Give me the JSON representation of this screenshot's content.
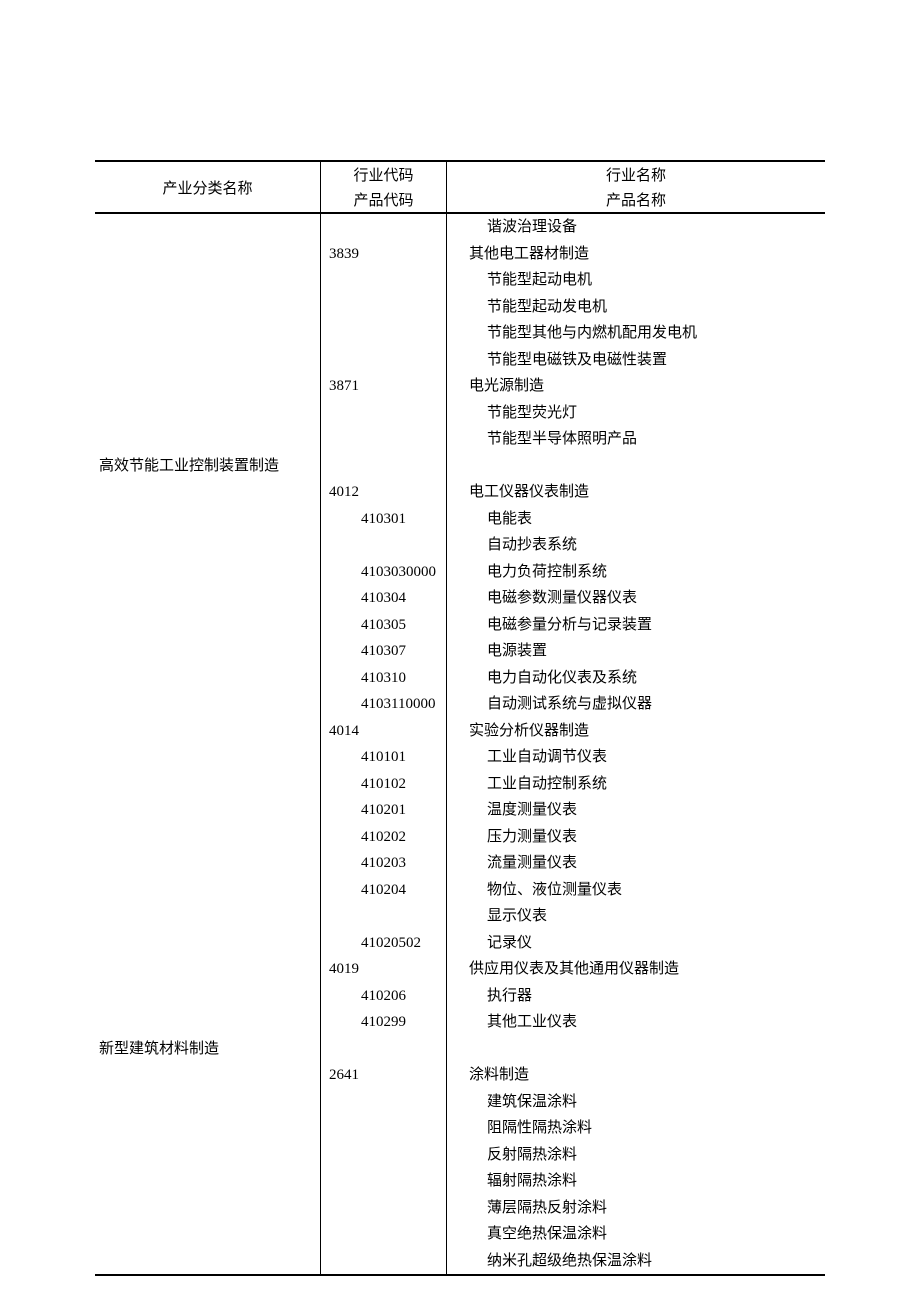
{
  "header": {
    "col1": "产业分类名称",
    "col2_line1": "行业代码",
    "col2_line2": "产品代码",
    "col3_line1": "行业名称",
    "col3_line2": "产品名称"
  },
  "rows": [
    {
      "category": "",
      "code": "",
      "codeLevel": "industry",
      "name": "谐波治理设备",
      "nameLevel": "product"
    },
    {
      "category": "",
      "code": "3839",
      "codeLevel": "industry",
      "name": "其他电工器材制造",
      "nameLevel": "industry"
    },
    {
      "category": "",
      "code": "",
      "codeLevel": "industry",
      "name": "节能型起动电机",
      "nameLevel": "product"
    },
    {
      "category": "",
      "code": "",
      "codeLevel": "industry",
      "name": "节能型起动发电机",
      "nameLevel": "product"
    },
    {
      "category": "",
      "code": "",
      "codeLevel": "industry",
      "name": "节能型其他与内燃机配用发电机",
      "nameLevel": "product"
    },
    {
      "category": "",
      "code": "",
      "codeLevel": "industry",
      "name": "节能型电磁铁及电磁性装置",
      "nameLevel": "product"
    },
    {
      "category": "",
      "code": "3871",
      "codeLevel": "industry",
      "name": "电光源制造",
      "nameLevel": "industry"
    },
    {
      "category": "",
      "code": "",
      "codeLevel": "industry",
      "name": "节能型荧光灯",
      "nameLevel": "product"
    },
    {
      "category": "",
      "code": "",
      "codeLevel": "industry",
      "name": "节能型半导体照明产品",
      "nameLevel": "product"
    },
    {
      "category": "高效节能工业控制装置制造",
      "code": "",
      "codeLevel": "industry",
      "name": "",
      "nameLevel": "industry"
    },
    {
      "category": "",
      "code": "4012",
      "codeLevel": "industry",
      "name": "电工仪器仪表制造",
      "nameLevel": "industry"
    },
    {
      "category": "",
      "code": "410301",
      "codeLevel": "product",
      "name": "电能表",
      "nameLevel": "product"
    },
    {
      "category": "",
      "code": "",
      "codeLevel": "product",
      "name": "自动抄表系统",
      "nameLevel": "product"
    },
    {
      "category": "",
      "code": "4103030000",
      "codeLevel": "product",
      "name": "电力负荷控制系统",
      "nameLevel": "product"
    },
    {
      "category": "",
      "code": "410304",
      "codeLevel": "product",
      "name": "电磁参数测量仪器仪表",
      "nameLevel": "product"
    },
    {
      "category": "",
      "code": "410305",
      "codeLevel": "product",
      "name": "电磁参量分析与记录装置",
      "nameLevel": "product"
    },
    {
      "category": "",
      "code": "410307",
      "codeLevel": "product",
      "name": "电源装置",
      "nameLevel": "product"
    },
    {
      "category": "",
      "code": "410310",
      "codeLevel": "product",
      "name": "电力自动化仪表及系统",
      "nameLevel": "product"
    },
    {
      "category": "",
      "code": "4103110000",
      "codeLevel": "product",
      "name": "自动测试系统与虚拟仪器",
      "nameLevel": "product"
    },
    {
      "category": "",
      "code": "4014",
      "codeLevel": "industry",
      "name": "实验分析仪器制造",
      "nameLevel": "industry"
    },
    {
      "category": "",
      "code": "410101",
      "codeLevel": "product",
      "name": "工业自动调节仪表",
      "nameLevel": "product"
    },
    {
      "category": "",
      "code": "410102",
      "codeLevel": "product",
      "name": "工业自动控制系统",
      "nameLevel": "product"
    },
    {
      "category": "",
      "code": "410201",
      "codeLevel": "product",
      "name": "温度测量仪表",
      "nameLevel": "product"
    },
    {
      "category": "",
      "code": "410202",
      "codeLevel": "product",
      "name": "压力测量仪表",
      "nameLevel": "product"
    },
    {
      "category": "",
      "code": "410203",
      "codeLevel": "product",
      "name": "流量测量仪表",
      "nameLevel": "product"
    },
    {
      "category": "",
      "code": "410204",
      "codeLevel": "product",
      "name": "物位、液位测量仪表",
      "nameLevel": "product"
    },
    {
      "category": "",
      "code": "",
      "codeLevel": "product",
      "name": "显示仪表",
      "nameLevel": "product"
    },
    {
      "category": "",
      "code": "41020502",
      "codeLevel": "product",
      "name": "记录仪",
      "nameLevel": "product"
    },
    {
      "category": "",
      "code": "4019",
      "codeLevel": "industry",
      "name": "供应用仪表及其他通用仪器制造",
      "nameLevel": "industry"
    },
    {
      "category": "",
      "code": "410206",
      "codeLevel": "product",
      "name": "执行器",
      "nameLevel": "product"
    },
    {
      "category": "",
      "code": "410299",
      "codeLevel": "product",
      "name": "其他工业仪表",
      "nameLevel": "product"
    },
    {
      "category": "新型建筑材料制造",
      "code": "",
      "codeLevel": "industry",
      "name": "",
      "nameLevel": "industry"
    },
    {
      "category": "",
      "code": "2641",
      "codeLevel": "industry",
      "name": "涂料制造",
      "nameLevel": "industry"
    },
    {
      "category": "",
      "code": "",
      "codeLevel": "industry",
      "name": "建筑保温涂料",
      "nameLevel": "product"
    },
    {
      "category": "",
      "code": "",
      "codeLevel": "industry",
      "name": "阻隔性隔热涂料",
      "nameLevel": "product"
    },
    {
      "category": "",
      "code": "",
      "codeLevel": "industry",
      "name": "反射隔热涂料",
      "nameLevel": "product"
    },
    {
      "category": "",
      "code": "",
      "codeLevel": "industry",
      "name": "辐射隔热涂料",
      "nameLevel": "product"
    },
    {
      "category": "",
      "code": "",
      "codeLevel": "industry",
      "name": "薄层隔热反射涂料",
      "nameLevel": "product"
    },
    {
      "category": "",
      "code": "",
      "codeLevel": "industry",
      "name": "真空绝热保温涂料",
      "nameLevel": "product"
    },
    {
      "category": "",
      "code": "",
      "codeLevel": "industry",
      "name": "纳米孔超级绝热保温涂料",
      "nameLevel": "product"
    }
  ]
}
